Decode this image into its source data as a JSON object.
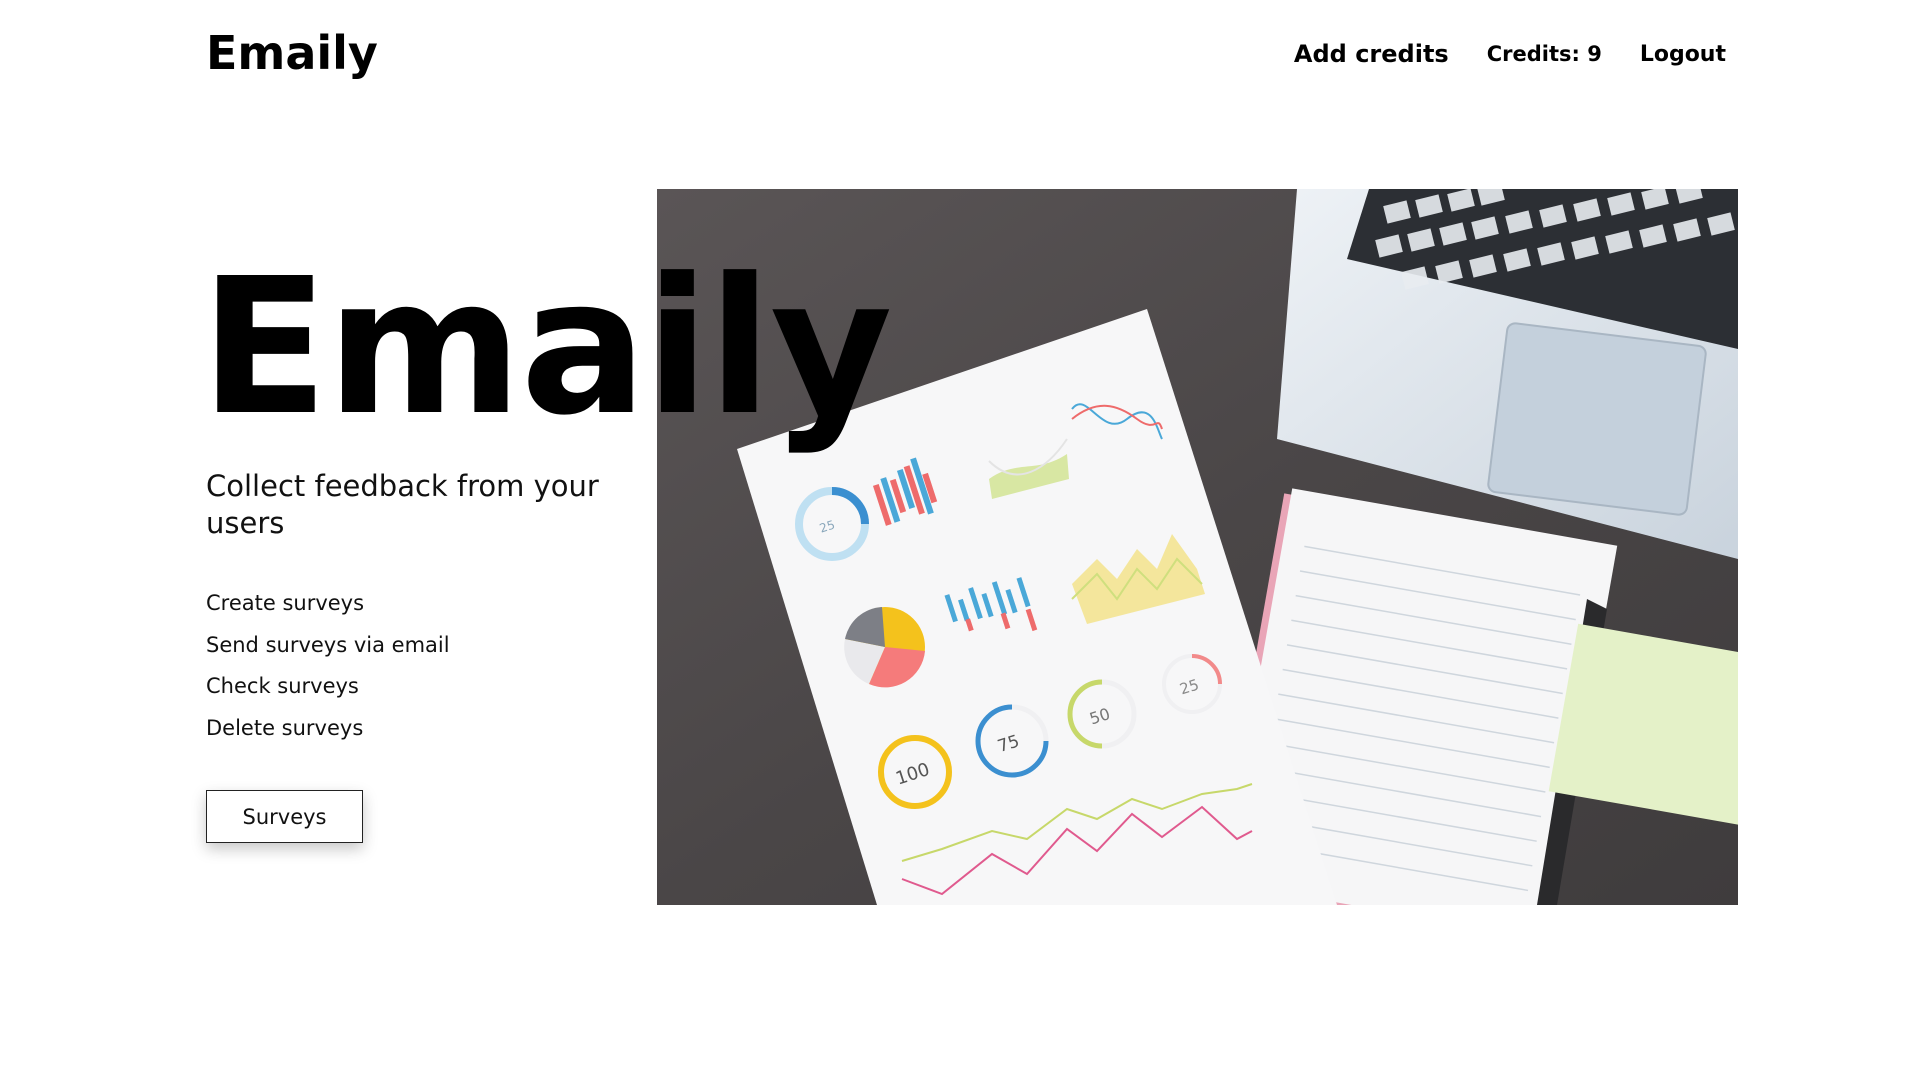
{
  "header": {
    "logo": "Emaily",
    "add_credits": "Add credits",
    "credits": "Credits: 9",
    "logout": "Logout"
  },
  "hero": {
    "title": "Emaily",
    "subtitle": "Collect feedback from your users",
    "features": [
      "Create surveys",
      "Send surveys via email",
      "Check surveys",
      "Delete surveys"
    ],
    "button_label": "Surveys",
    "image_alt": "desk with laptop, notebook and printed charts"
  },
  "image_text": {
    "gauge_100": "100",
    "gauge_75": "75",
    "gauge_50": "50",
    "gauge_25": "25",
    "donut_25": "25"
  },
  "colors": {
    "text": "#000000",
    "desk": "#4d4a4b",
    "paper": "#f7f7f8",
    "chart_blue": "#3b8fd0",
    "chart_red": "#ee6b6b",
    "chart_yellow": "#f4c21c",
    "chart_green": "#c7d86a"
  }
}
